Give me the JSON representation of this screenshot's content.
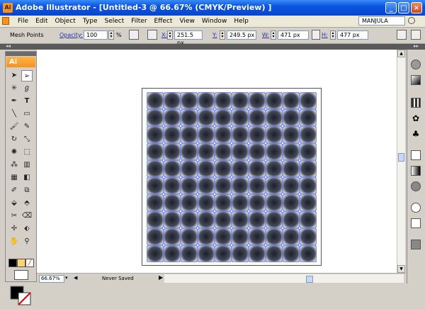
{
  "window": {
    "title": "Adobe Illustrator - [Untitled-3 @ 66.67% (CMYK/Preview) ]",
    "controls": [
      "_",
      "□",
      "×"
    ]
  },
  "menubar": {
    "items": [
      "File",
      "Edit",
      "Object",
      "Type",
      "Select",
      "Filter",
      "Effect",
      "View",
      "Window",
      "Help"
    ],
    "user": "MANJULA"
  },
  "control_bar": {
    "tool_label": "Mesh Points",
    "opacity_label": "Opacity:",
    "opacity_value": "100",
    "percent": "%",
    "x_label": "X:",
    "x_value": "251.5 px",
    "y_label": "Y:",
    "y_value": "249.5 px",
    "w_label": "W:",
    "w_value": "471 px",
    "h_label": "H:",
    "h_value": "477 px"
  },
  "toolbox": {
    "logo": "Ai"
  },
  "status_bar": {
    "zoom": "66.67%",
    "status": "Never Saved"
  },
  "colors": {
    "mesh_line": "#4a6cff",
    "mesh_dark": "#1c1f2a",
    "mesh_light": "#c8c8d0",
    "title_blue": "#0a54e3",
    "ai_orange": "#f7931e"
  }
}
